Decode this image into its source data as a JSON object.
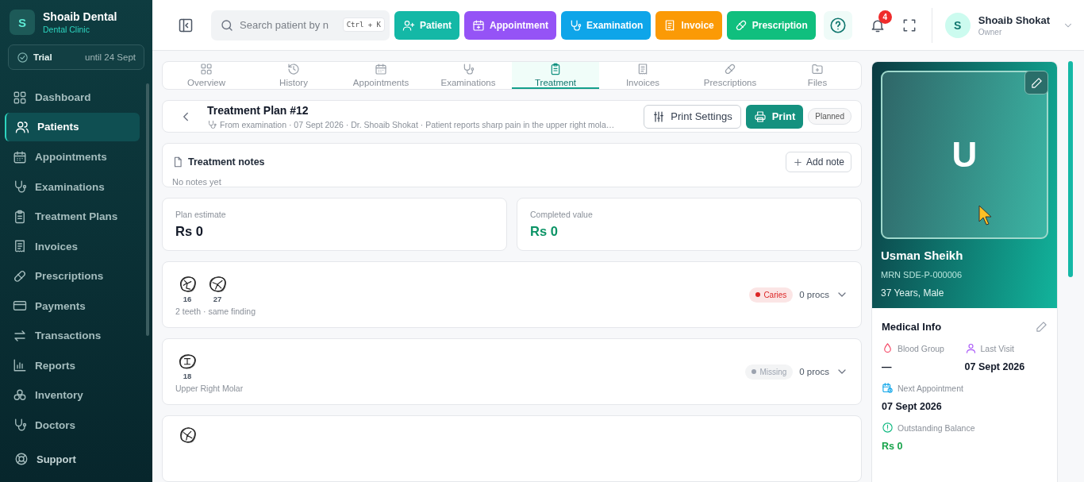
{
  "sidebar": {
    "brand": {
      "initial": "S",
      "name": "Shoaib Dental",
      "subtitle": "Dental Clinic"
    },
    "trial": {
      "label": "Trial",
      "until": "until 24 Sept"
    },
    "items": [
      {
        "label": "Dashboard",
        "selected": false
      },
      {
        "label": "Patients",
        "selected": true
      },
      {
        "label": "Appointments",
        "selected": false
      },
      {
        "label": "Examinations",
        "selected": false
      },
      {
        "label": "Treatment Plans",
        "selected": false
      },
      {
        "label": "Invoices",
        "selected": false
      },
      {
        "label": "Prescriptions",
        "selected": false
      },
      {
        "label": "Payments",
        "selected": false
      },
      {
        "label": "Transactions",
        "selected": false
      },
      {
        "label": "Reports",
        "selected": false
      },
      {
        "label": "Inventory",
        "selected": false
      },
      {
        "label": "Doctors",
        "selected": false
      }
    ],
    "support": "Support"
  },
  "header": {
    "search": {
      "placeholder": "Search patient by n",
      "shortcut": "Ctrl + K"
    },
    "actions": [
      {
        "label": "Patient",
        "color": "#14b8a6"
      },
      {
        "label": "Appointment",
        "color": "#9553f6"
      },
      {
        "label": "Examination",
        "color": "#0ea5e9"
      },
      {
        "label": "Invoice",
        "color": "#fb9a06"
      },
      {
        "label": "Prescription",
        "color": "#10bf7e"
      }
    ],
    "notifications": "4",
    "user": {
      "initial": "S",
      "name": "Shoaib Shokat",
      "role": "Owner"
    }
  },
  "tabs": [
    {
      "label": "Overview",
      "selected": false
    },
    {
      "label": "History",
      "selected": false
    },
    {
      "label": "Appointments",
      "selected": false
    },
    {
      "label": "Examinations",
      "selected": false
    },
    {
      "label": "Treatment",
      "selected": true
    },
    {
      "label": "Invoices",
      "selected": false
    },
    {
      "label": "Prescriptions",
      "selected": false
    },
    {
      "label": "Files",
      "selected": false
    }
  ],
  "plan": {
    "title": "Treatment Plan #12",
    "meta": "From examination · 07 Sept 2026 · Dr. Shoaib Shokat · Patient reports sharp pain in the upper right mola…",
    "print_settings": "Print Settings",
    "print": "Print",
    "status": "Planned"
  },
  "notes": {
    "title": "Treatment notes",
    "add": "Add note",
    "empty": "No notes yet"
  },
  "stats": [
    {
      "label": "Plan estimate",
      "value": "Rs 0",
      "kind": "plain"
    },
    {
      "label": "Completed value",
      "value": "Rs 0",
      "kind": "positive"
    }
  ],
  "findings": [
    {
      "teeth": [
        "16",
        "27"
      ],
      "caption": "2 teeth · same finding",
      "badge": "Caries",
      "color": "#dc2626",
      "procs": "0 procs"
    },
    {
      "teeth": [
        "18"
      ],
      "caption": "Upper Right Molar",
      "badge": "Missing",
      "color": "#9ca3af",
      "procs": "0 procs"
    },
    {
      "kind": "cut"
    }
  ],
  "patient": {
    "initial": "U",
    "name": "Usman Sheikh",
    "mrn": "MRN SDE-P-000006",
    "age": "37 Years, Male",
    "medical": {
      "title": "Medical Info",
      "fields": [
        {
          "label": "Blood Group",
          "value": "—",
          "kind": "plain"
        },
        {
          "label": "Last Visit",
          "value": "07 Sept 2026",
          "kind": "plain"
        },
        {
          "label": "Next Appointment",
          "value": "07 Sept 2026",
          "kind": "plain"
        },
        {
          "label": "Outstanding Balance",
          "value": "Rs 0",
          "kind": "money"
        }
      ]
    }
  }
}
